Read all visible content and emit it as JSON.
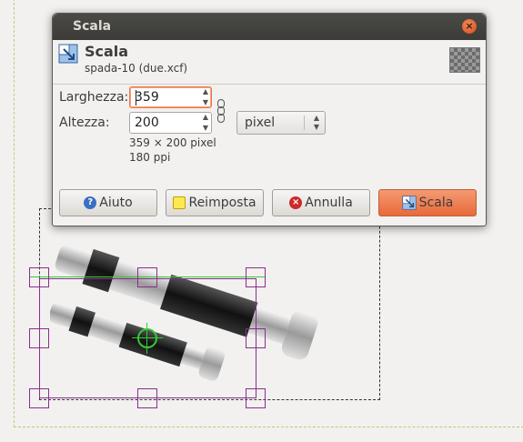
{
  "dialog": {
    "window_title": "Scala",
    "header_title": "Scala",
    "header_subtitle": "spada-10 (due.xcf)",
    "width_label": "Larghezza:",
    "width_value": "359",
    "height_label": "Altezza:",
    "height_value": "200",
    "unit_value": "pixel",
    "size_info": "359 × 200 pixel",
    "resolution_info": "180 ppi",
    "buttons": {
      "help": "Aiuto",
      "reset": "Reimposta",
      "cancel": "Annulla",
      "scale": "Scala"
    }
  },
  "colors": {
    "accent": "#e8693a",
    "handles": "#8a2e8e",
    "guides": "#33cc33"
  },
  "icons": [
    "scale-icon",
    "close-icon",
    "chain-icon",
    "help-icon",
    "reset-icon",
    "cancel-icon",
    "spin-up-icon",
    "spin-down-icon",
    "dropdown-icon"
  ]
}
